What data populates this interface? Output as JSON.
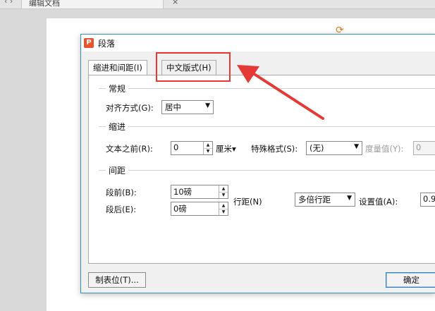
{
  "app": {
    "tab_text": "编辑文档",
    "close_glyph": "×",
    "nav_glyph": "‹ ›"
  },
  "dialog": {
    "title": "段落",
    "app_icon_glyph": "P",
    "tabs": [
      {
        "label": "缩进和间距(I)"
      },
      {
        "label": "中文版式(H)"
      }
    ],
    "general": {
      "title": "常规",
      "align_label": "对齐方式(G):",
      "align_value": "居中"
    },
    "indent": {
      "title": "缩进",
      "before_label": "文本之前(R):",
      "before_value": "0",
      "before_unit": "厘米▾",
      "special_label": "特殊格式(S):",
      "special_value": "(无)",
      "measure_label": "度量值(Y):",
      "measure_value": "0"
    },
    "spacing": {
      "title": "间距",
      "before_label": "段前(B):",
      "before_value": "10磅",
      "after_label": "段后(E):",
      "after_value": "0磅",
      "line_label": "行距(N)",
      "line_value": "多倍行距",
      "setting_label": "设置值(A):",
      "setting_value": "0.9"
    },
    "footer": {
      "tabs_button": "制表位(T)...",
      "ok_button": "确定"
    }
  },
  "colors": {
    "highlight": "#e53935",
    "dialog_border": "#3a8fb7",
    "app_icon": "#e8542b"
  }
}
